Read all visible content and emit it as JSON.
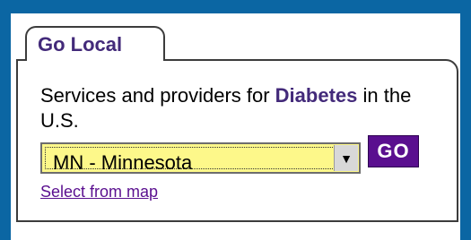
{
  "widget": {
    "tab_title": "Go Local",
    "description_prefix": "Services and providers for ",
    "condition": "Diabetes",
    "description_suffix": " in the U.S.",
    "state_select": {
      "selected": "MN - Minnesota",
      "arrow_icon": "chevron-down-icon"
    },
    "go_button_label": "GO",
    "map_link_label": "Select from map"
  },
  "colors": {
    "background_blue": "#0b66a3",
    "accent_purple": "#5a0f8f",
    "title_purple": "#432a7a",
    "select_yellow": "#fdf88a"
  }
}
